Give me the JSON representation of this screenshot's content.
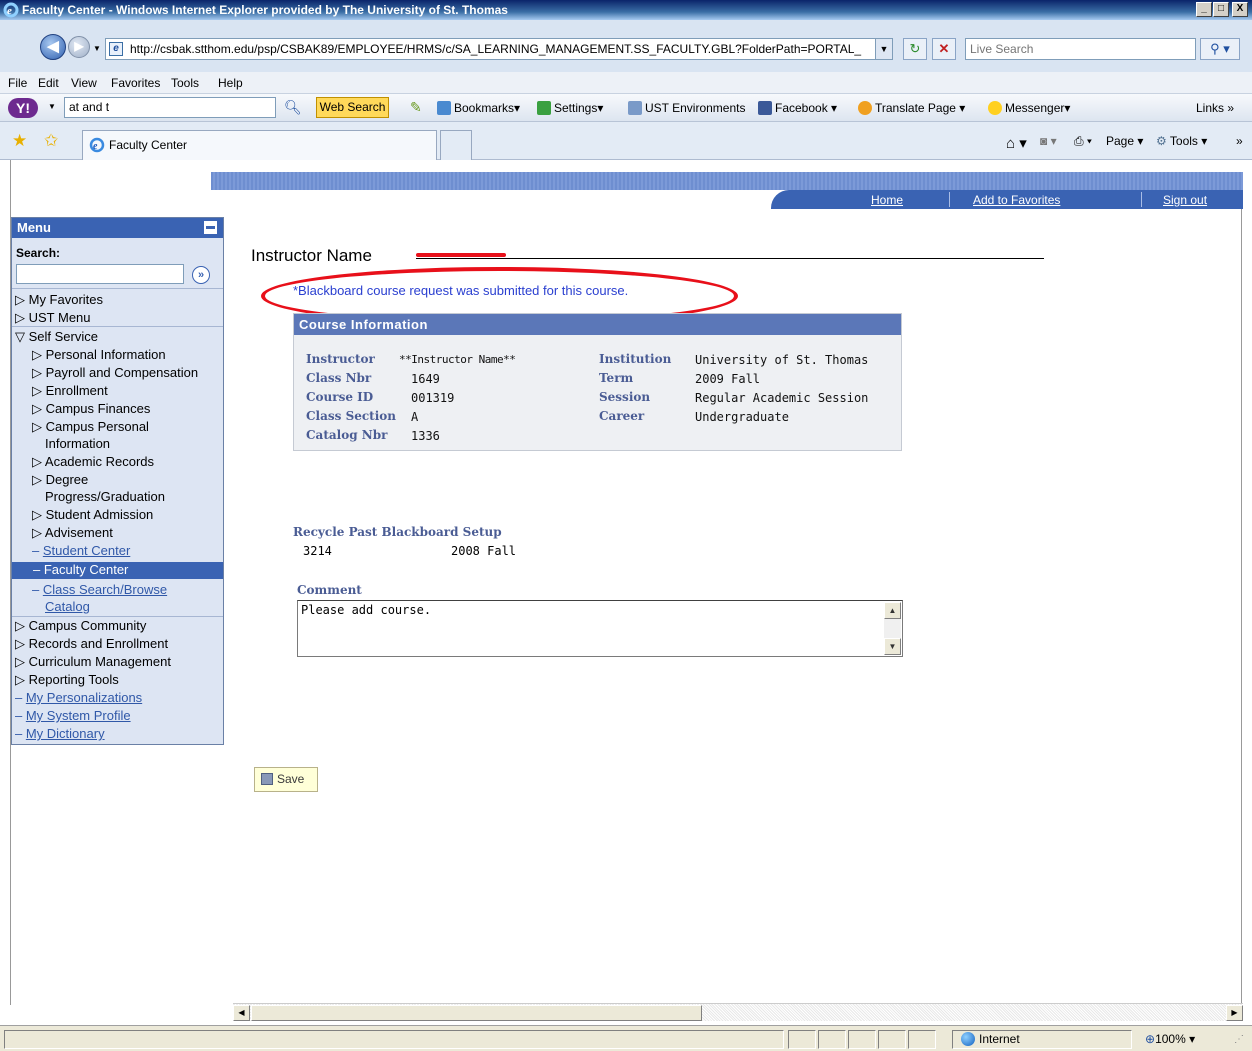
{
  "window": {
    "title": "Faculty Center - Windows Internet Explorer provided by The University of St. Thomas",
    "controls": {
      "minimize": "_",
      "maximize": "□",
      "close": "X"
    }
  },
  "address": {
    "url": "http://csbak.stthom.edu/psp/CSBAK89/EMPLOYEE/HRMS/c/SA_LEARNING_MANAGEMENT.SS_FACULTY.GBL?FolderPath=PORTAL_",
    "search_placeholder": "Live Search"
  },
  "menubar": [
    "File",
    "Edit",
    "View",
    "Favorites",
    "Tools",
    "Help"
  ],
  "yahoo": {
    "query": "at and t",
    "search_label": "Web Search",
    "items": [
      "Bookmarks▾",
      "Settings▾",
      "UST Environments",
      "Facebook ▾",
      "Translate Page ▾",
      "Messenger▾"
    ],
    "links_label": "Links"
  },
  "tabs": {
    "active": "Faculty Center"
  },
  "commandbar": {
    "page": "Page ▾",
    "tools": "Tools ▾"
  },
  "portal_nav": {
    "home": "Home",
    "favorites": "Add to Favorites",
    "signout": "Sign out"
  },
  "menu": {
    "title": "Menu",
    "search_label": "Search:",
    "items": [
      {
        "label": "My Favorites"
      },
      {
        "label": "UST Menu"
      },
      {
        "label": "Self Service"
      },
      {
        "label": "Personal Information"
      },
      {
        "label": "Payroll and Compensation"
      },
      {
        "label": "Enrollment"
      },
      {
        "label": "Campus Finances"
      },
      {
        "label": "Campus Personal"
      },
      {
        "label": "Information"
      },
      {
        "label": "Academic Records"
      },
      {
        "label": "Degree"
      },
      {
        "label": "Progress/Graduation"
      },
      {
        "label": "Student Admission"
      },
      {
        "label": "Advisement"
      },
      {
        "label": "Student Center"
      },
      {
        "label": "Faculty Center"
      },
      {
        "label": "Class Search/Browse"
      },
      {
        "label": "Catalog"
      },
      {
        "label": "Campus Community"
      },
      {
        "label": "Records and Enrollment"
      },
      {
        "label": "Curriculum Management"
      },
      {
        "label": "Reporting Tools"
      },
      {
        "label": "My Personalizations"
      },
      {
        "label": "My System Profile"
      },
      {
        "label": "My Dictionary"
      }
    ]
  },
  "content": {
    "instructor_heading": "Instructor Name",
    "submitted_msg": "*Blackboard course request was submitted for this course.",
    "course_header": "Course Information",
    "fields": {
      "instructor_label": "Instructor",
      "instructor_value": "**Instructor Name**",
      "classnbr_label": "Class Nbr",
      "classnbr_value": "1649",
      "courseid_label": "Course ID",
      "courseid_value": "001319",
      "section_label": "Class Section",
      "section_value": "A",
      "catalog_label": "Catalog Nbr",
      "catalog_value": "1336",
      "institution_label": "Institution",
      "institution_value": "University of St. Thomas",
      "term_label": "Term",
      "term_value": "2009 Fall",
      "session_label": "Session",
      "session_value": "Regular Academic Session",
      "career_label": "Career",
      "career_value": "Undergraduate"
    },
    "recycle_label": "Recycle Past Blackboard Setup",
    "recycle_id": "3214",
    "recycle_term": "2008 Fall",
    "comment_label": "Comment",
    "comment_value": "Please add course.",
    "save_label": "Save"
  },
  "status": {
    "zone": "Internet",
    "zoom": "100%"
  }
}
